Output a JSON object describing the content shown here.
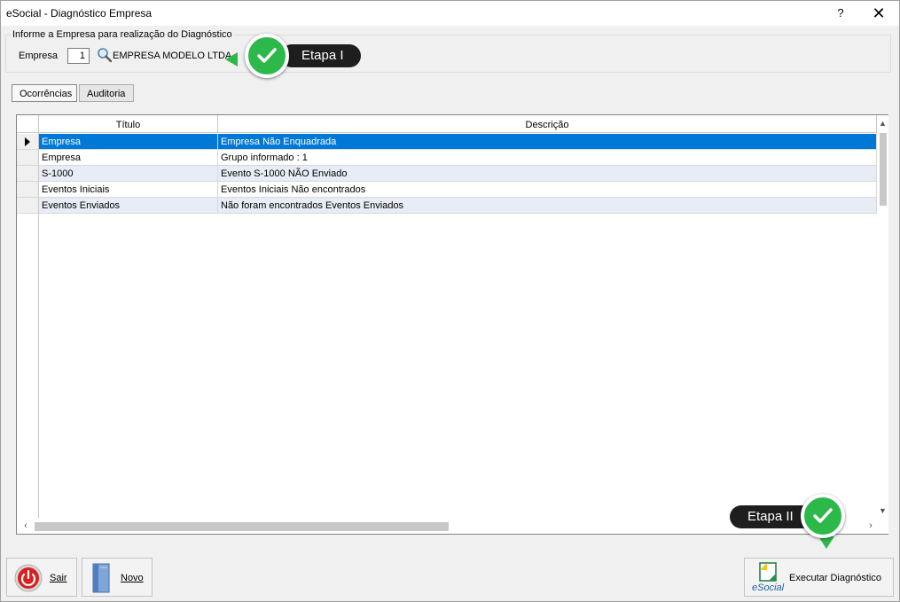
{
  "window": {
    "title": "eSocial - Diagnóstico Empresa",
    "help_label": "?",
    "close_label": "✕"
  },
  "company_group": {
    "legend": "Informe a Empresa para realização do Diagnóstico",
    "label": "Empresa",
    "code": "1",
    "name": "EMPRESA MODELO LTDA"
  },
  "tabs": [
    {
      "label": "Ocorrências",
      "active": true
    },
    {
      "label": "Auditoria",
      "active": false
    }
  ],
  "grid": {
    "columns": [
      "Título",
      "Descrição"
    ],
    "rows": [
      {
        "titulo": "Empresa",
        "descricao": "Empresa Não Enquadrada"
      },
      {
        "titulo": "Empresa",
        "descricao": "Grupo informado : 1"
      },
      {
        "titulo": "S-1000",
        "descricao": "Evento S-1000 NÃO Enviado"
      },
      {
        "titulo": "Eventos Iniciais",
        "descricao": "Eventos Iniciais Não encontrados"
      },
      {
        "titulo": "Eventos Enviados",
        "descricao": "Não foram encontrados Eventos Enviados"
      }
    ],
    "selected_row": 0
  },
  "buttons": {
    "sair": "Sair",
    "novo": "Novo",
    "executar": "Executar Diagnóstico",
    "esocial_logo_text": "eSocial"
  },
  "callouts": {
    "etapa1": "Etapa I",
    "etapa2": "Etapa II"
  },
  "colors": {
    "selection": "#0078d7",
    "alt_row": "#e8ecf6",
    "check_green": "#2db84a",
    "badge_dark": "#1e1e1e"
  }
}
